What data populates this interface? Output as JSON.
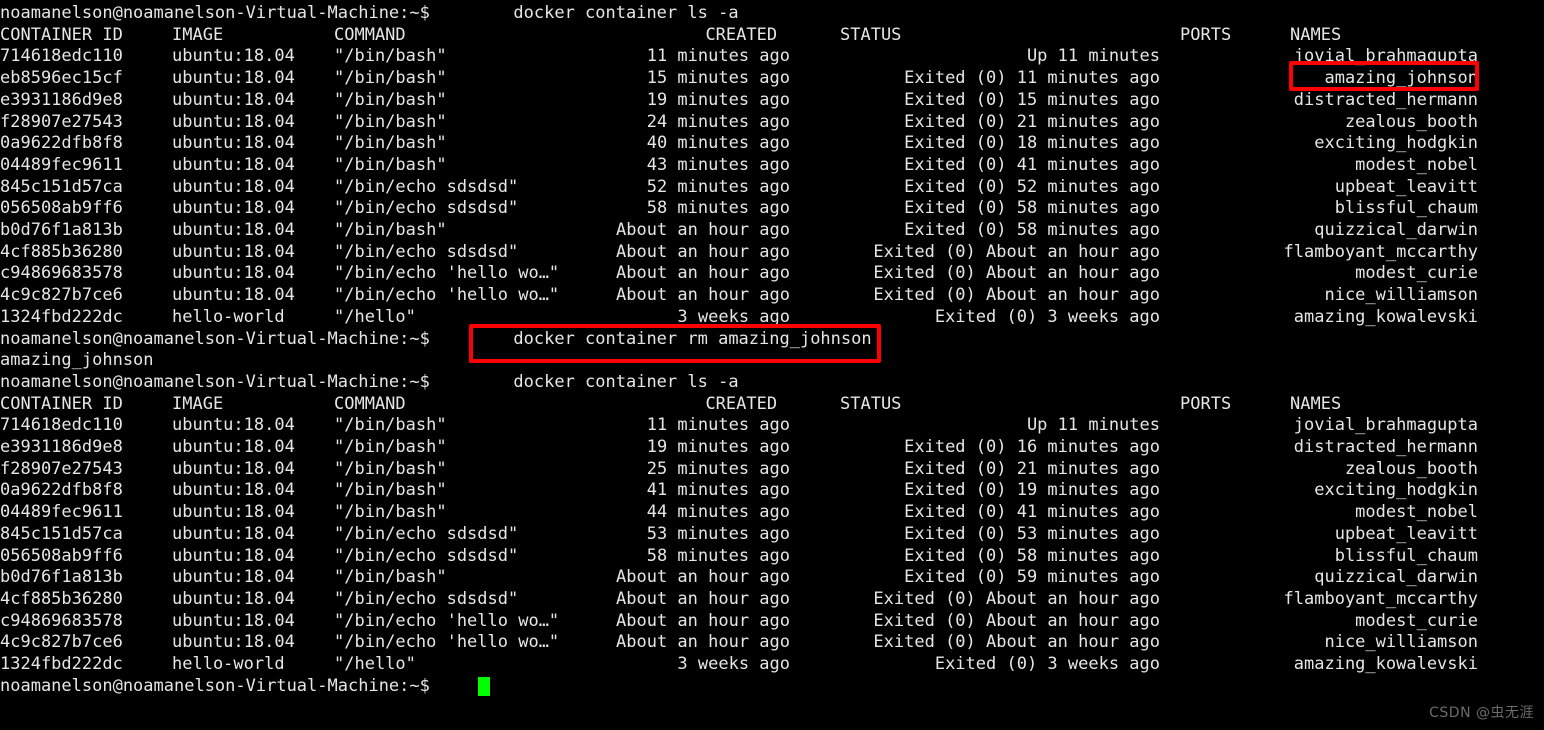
{
  "terminal": {
    "user_host": "noamanelson@noamanelson-Virtual-Machine:~$",
    "bg_color": "#000000",
    "fg_color": "#e6e6e6",
    "cursor_color": "#00ff00",
    "highlight_color": "#ff0000"
  },
  "commands": {
    "list_all_1": "docker container ls -a",
    "remove": "docker container rm amazing_johnson",
    "remove_output": "amazing_johnson",
    "list_all_2": "docker container ls -a"
  },
  "headers": {
    "container_id": "CONTAINER ID",
    "image": "IMAGE",
    "command": "COMMAND",
    "created": "CREATED",
    "status": "STATUS",
    "ports": "PORTS",
    "names": "NAMES"
  },
  "table1": [
    {
      "id": "714618edc110",
      "image": "ubuntu:18.04",
      "command": "\"/bin/bash\"",
      "created": "11 minutes ago",
      "status": "Up 11 minutes",
      "ports": "",
      "names": "jovial_brahmagupta"
    },
    {
      "id": "eb8596ec15cf",
      "image": "ubuntu:18.04",
      "command": "\"/bin/bash\"",
      "created": "15 minutes ago",
      "status": "Exited (0) 11 minutes ago",
      "ports": "",
      "names": "amazing_johnson"
    },
    {
      "id": "e3931186d9e8",
      "image": "ubuntu:18.04",
      "command": "\"/bin/bash\"",
      "created": "19 minutes ago",
      "status": "Exited (0) 15 minutes ago",
      "ports": "",
      "names": "distracted_hermann"
    },
    {
      "id": "f28907e27543",
      "image": "ubuntu:18.04",
      "command": "\"/bin/bash\"",
      "created": "24 minutes ago",
      "status": "Exited (0) 21 minutes ago",
      "ports": "",
      "names": "zealous_booth"
    },
    {
      "id": "0a9622dfb8f8",
      "image": "ubuntu:18.04",
      "command": "\"/bin/bash\"",
      "created": "40 minutes ago",
      "status": "Exited (0) 18 minutes ago",
      "ports": "",
      "names": "exciting_hodgkin"
    },
    {
      "id": "04489fec9611",
      "image": "ubuntu:18.04",
      "command": "\"/bin/bash\"",
      "created": "43 minutes ago",
      "status": "Exited (0) 41 minutes ago",
      "ports": "",
      "names": "modest_nobel"
    },
    {
      "id": "845c151d57ca",
      "image": "ubuntu:18.04",
      "command": "\"/bin/echo sdsdsd\"",
      "created": "52 minutes ago",
      "status": "Exited (0) 52 minutes ago",
      "ports": "",
      "names": "upbeat_leavitt"
    },
    {
      "id": "056508ab9ff6",
      "image": "ubuntu:18.04",
      "command": "\"/bin/echo sdsdsd\"",
      "created": "58 minutes ago",
      "status": "Exited (0) 58 minutes ago",
      "ports": "",
      "names": "blissful_chaum"
    },
    {
      "id": "b0d76f1a813b",
      "image": "ubuntu:18.04",
      "command": "\"/bin/bash\"",
      "created": "About an hour ago",
      "status": "Exited (0) 58 minutes ago",
      "ports": "",
      "names": "quizzical_darwin"
    },
    {
      "id": "4cf885b36280",
      "image": "ubuntu:18.04",
      "command": "\"/bin/echo sdsdsd\"",
      "created": "About an hour ago",
      "status": "Exited (0) About an hour ago",
      "ports": "",
      "names": "flamboyant_mccarthy"
    },
    {
      "id": "c94869683578",
      "image": "ubuntu:18.04",
      "command": "\"/bin/echo 'hello wo…\"",
      "created": "About an hour ago",
      "status": "Exited (0) About an hour ago",
      "ports": "",
      "names": "modest_curie"
    },
    {
      "id": "4c9c827b7ce6",
      "image": "ubuntu:18.04",
      "command": "\"/bin/echo 'hello wo…\"",
      "created": "About an hour ago",
      "status": "Exited (0) About an hour ago",
      "ports": "",
      "names": "nice_williamson"
    },
    {
      "id": "1324fbd222dc",
      "image": "hello-world",
      "command": "\"/hello\"",
      "created": "3 weeks ago",
      "status": "Exited (0) 3 weeks ago",
      "ports": "",
      "names": "amazing_kowalevski"
    }
  ],
  "table2": [
    {
      "id": "714618edc110",
      "image": "ubuntu:18.04",
      "command": "\"/bin/bash\"",
      "created": "11 minutes ago",
      "status": "Up 11 minutes",
      "ports": "",
      "names": "jovial_brahmagupta"
    },
    {
      "id": "e3931186d9e8",
      "image": "ubuntu:18.04",
      "command": "\"/bin/bash\"",
      "created": "19 minutes ago",
      "status": "Exited (0) 16 minutes ago",
      "ports": "",
      "names": "distracted_hermann"
    },
    {
      "id": "f28907e27543",
      "image": "ubuntu:18.04",
      "command": "\"/bin/bash\"",
      "created": "25 minutes ago",
      "status": "Exited (0) 21 minutes ago",
      "ports": "",
      "names": "zealous_booth"
    },
    {
      "id": "0a9622dfb8f8",
      "image": "ubuntu:18.04",
      "command": "\"/bin/bash\"",
      "created": "41 minutes ago",
      "status": "Exited (0) 19 minutes ago",
      "ports": "",
      "names": "exciting_hodgkin"
    },
    {
      "id": "04489fec9611",
      "image": "ubuntu:18.04",
      "command": "\"/bin/bash\"",
      "created": "44 minutes ago",
      "status": "Exited (0) 41 minutes ago",
      "ports": "",
      "names": "modest_nobel"
    },
    {
      "id": "845c151d57ca",
      "image": "ubuntu:18.04",
      "command": "\"/bin/echo sdsdsd\"",
      "created": "53 minutes ago",
      "status": "Exited (0) 53 minutes ago",
      "ports": "",
      "names": "upbeat_leavitt"
    },
    {
      "id": "056508ab9ff6",
      "image": "ubuntu:18.04",
      "command": "\"/bin/echo sdsdsd\"",
      "created": "58 minutes ago",
      "status": "Exited (0) 58 minutes ago",
      "ports": "",
      "names": "blissful_chaum"
    },
    {
      "id": "b0d76f1a813b",
      "image": "ubuntu:18.04",
      "command": "\"/bin/bash\"",
      "created": "About an hour ago",
      "status": "Exited (0) 59 minutes ago",
      "ports": "",
      "names": "quizzical_darwin"
    },
    {
      "id": "4cf885b36280",
      "image": "ubuntu:18.04",
      "command": "\"/bin/echo sdsdsd\"",
      "created": "About an hour ago",
      "status": "Exited (0) About an hour ago",
      "ports": "",
      "names": "flamboyant_mccarthy"
    },
    {
      "id": "c94869683578",
      "image": "ubuntu:18.04",
      "command": "\"/bin/echo 'hello wo…\"",
      "created": "About an hour ago",
      "status": "Exited (0) About an hour ago",
      "ports": "",
      "names": "modest_curie"
    },
    {
      "id": "4c9c827b7ce6",
      "image": "ubuntu:18.04",
      "command": "\"/bin/echo 'hello wo…\"",
      "created": "About an hour ago",
      "status": "Exited (0) About an hour ago",
      "ports": "",
      "names": "nice_williamson"
    },
    {
      "id": "1324fbd222dc",
      "image": "hello-world",
      "command": "\"/hello\"",
      "created": "3 weeks ago",
      "status": "Exited (0) 3 weeks ago",
      "ports": "",
      "names": "amazing_kowalevski"
    }
  ],
  "highlights": [
    {
      "name": "highlight-amazing-johnson-name",
      "target": "amazing_johnson"
    },
    {
      "name": "highlight-rm-command",
      "target": "docker container rm amazing_johnson"
    }
  ],
  "watermark": "CSDN @虫无涯"
}
